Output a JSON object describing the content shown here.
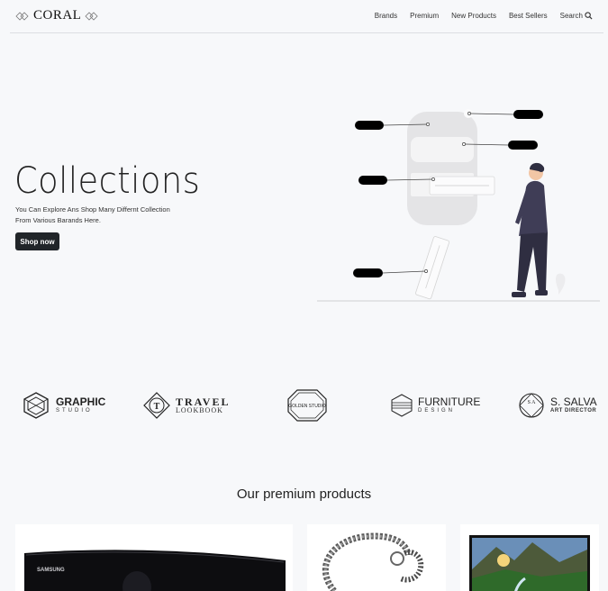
{
  "nav": {
    "brand": "CORAL",
    "links": [
      "Brands",
      "Premium",
      "New Products",
      "Best Sellers"
    ],
    "search_label": "Search"
  },
  "hero": {
    "title": "Collections",
    "subtitle_line1": "You Can Explore Ans Shop Many Differnt Collection",
    "subtitle_line2": "From Various Barands Here.",
    "button_label": "Shop now"
  },
  "brands": [
    {
      "main": "GRAPHIC",
      "sub": "STUDIO"
    },
    {
      "main": "TRAVEL",
      "sub": "LOOKBOOK"
    },
    {
      "main": "GOLDEN STUDIO",
      "sub": ""
    },
    {
      "main": "FURNITURE",
      "sub": "DESIGN"
    },
    {
      "main": "S. SALVA",
      "sub": "ART DIRECTOR",
      "seal": "S A"
    }
  ],
  "section": {
    "title": "Our premium products"
  },
  "products": [
    {
      "name": "monitor",
      "label": "SAMSUNG"
    },
    {
      "name": "bracelet"
    },
    {
      "name": "landscape-frame"
    }
  ],
  "colors": {
    "dark": "#212529",
    "background": "#f7f8fa",
    "accent": "#2f2e41"
  }
}
